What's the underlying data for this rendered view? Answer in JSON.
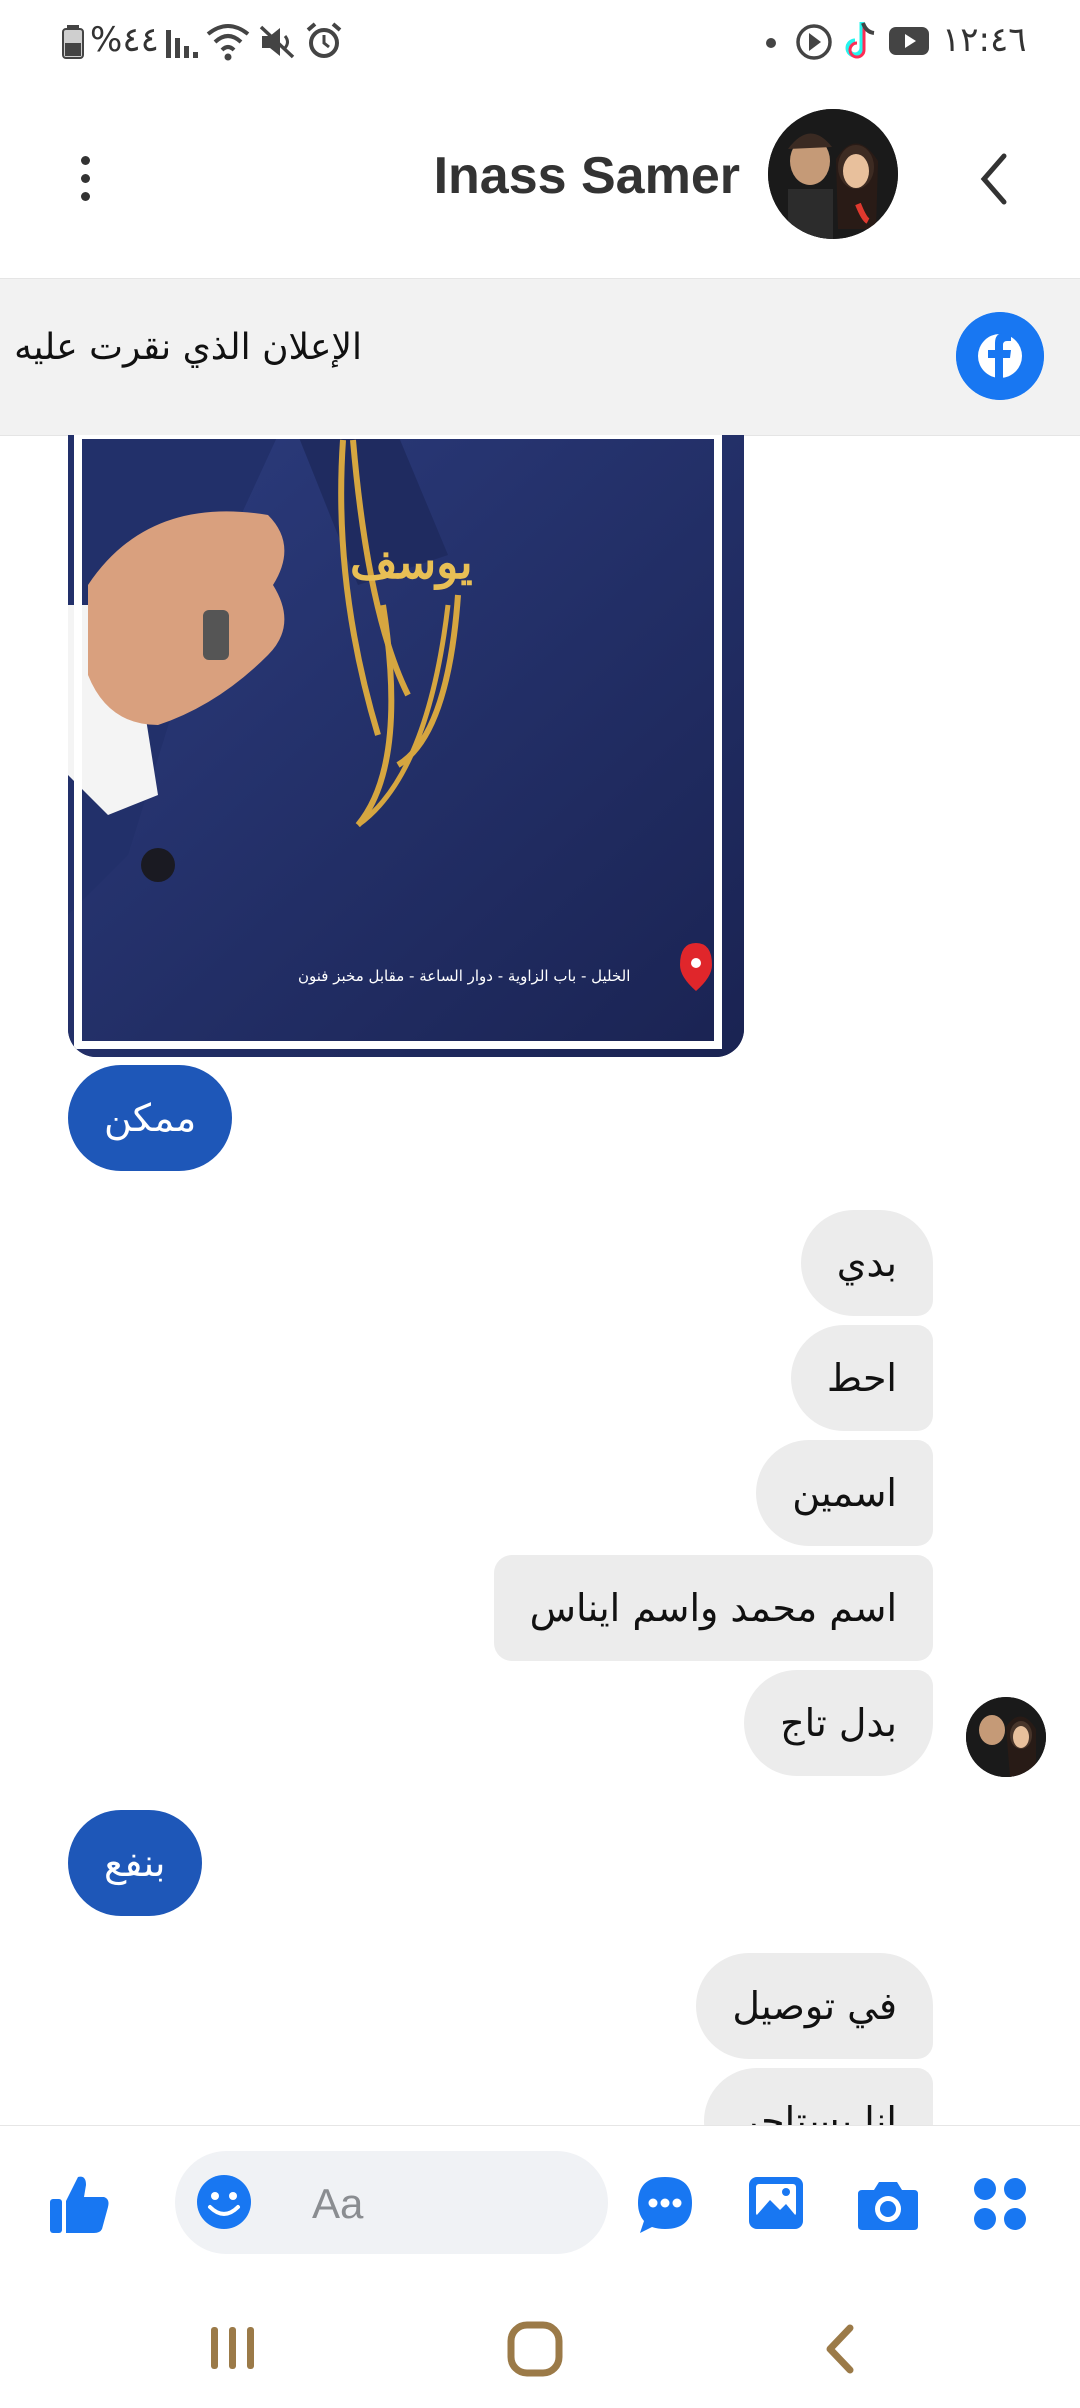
{
  "status_bar": {
    "battery_percent": "%٤٤",
    "time": "١٢:٤٦"
  },
  "header": {
    "contact_name": "Inass Samer"
  },
  "ad_banner": {
    "text": "الإعلان الذي نقرت عليه"
  },
  "photo": {
    "pin_label": "الخليل - باب الزاوية - دوار الساعة - مقابل مخبز فنون",
    "brooch_text": "يوسف"
  },
  "messages": [
    {
      "from": "me",
      "text": "ممكن"
    },
    {
      "from": "them",
      "text": "بدي"
    },
    {
      "from": "them",
      "text": "احط"
    },
    {
      "from": "them",
      "text": "اسمين"
    },
    {
      "from": "them",
      "text": "اسم محمد واسم ايناس"
    },
    {
      "from": "them",
      "text": "بدل تاج"
    },
    {
      "from": "me",
      "text": "بنفع"
    },
    {
      "from": "them",
      "text": "في توصيل"
    },
    {
      "from": "them",
      "text": "انا بستاجر"
    }
  ],
  "composer": {
    "placeholder": "Aa"
  },
  "colors": {
    "brand_blue": "#1877f2",
    "outgoing_bubble": "#1e57b8",
    "incoming_bubble": "#ececec"
  }
}
